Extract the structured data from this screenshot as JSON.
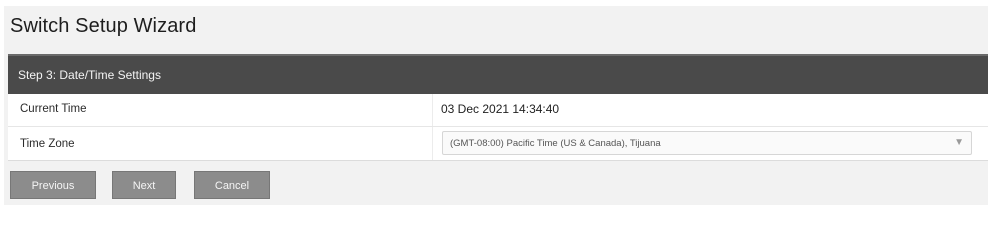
{
  "wizard": {
    "title": "Switch Setup Wizard",
    "step_header": "Step 3: Date/Time Settings"
  },
  "fields": {
    "current_time": {
      "label": "Current Time",
      "value": "03 Dec 2021 14:34:40"
    },
    "time_zone": {
      "label": "Time Zone",
      "selected": "(GMT-08:00) Pacific Time (US & Canada), Tijuana"
    }
  },
  "buttons": {
    "previous": "Previous",
    "next": "Next",
    "cancel": "Cancel"
  },
  "icons": {
    "time_zone_dropdown": "chevron-down-icon"
  },
  "colors": {
    "header_bar": "#4a4a4a",
    "button": "#8c8c8c",
    "panel_bg": "#f2f2f2"
  }
}
